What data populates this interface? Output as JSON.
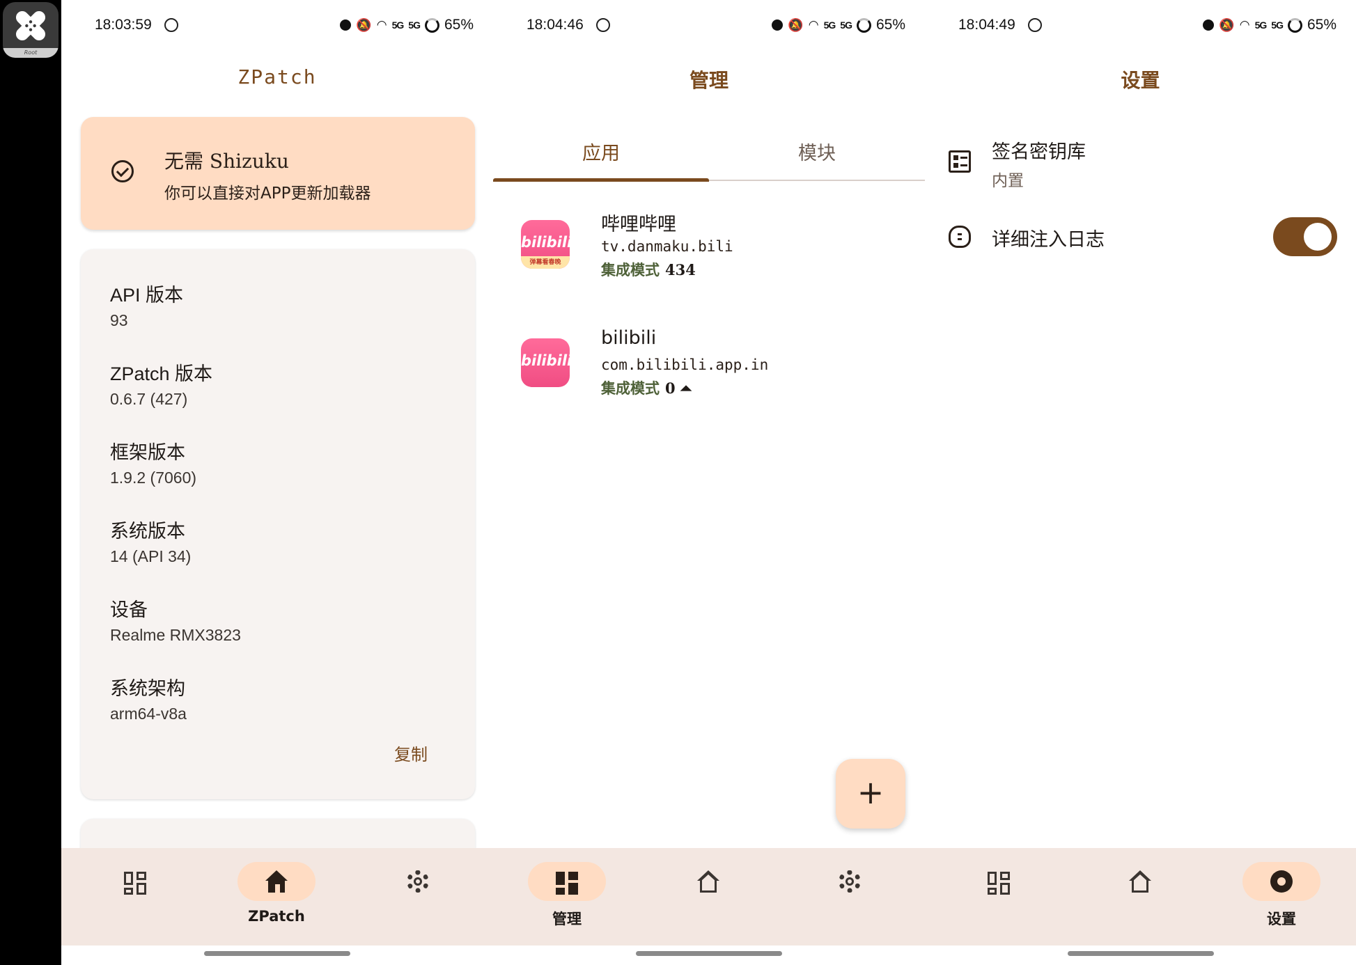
{
  "overlay": {
    "badge_label": "Root"
  },
  "panels": [
    {
      "status": {
        "time": "18:03:59",
        "battery": "65%",
        "signal1": "5G",
        "signal2": "5G"
      },
      "title": "ZPatch",
      "status_card": {
        "title": "无需 Shizuku",
        "subtitle": "你可以直接对APP更新加载器"
      },
      "info": [
        {
          "label": "API 版本",
          "value": "93"
        },
        {
          "label": "ZPatch 版本",
          "value": "0.6.7 (427)"
        },
        {
          "label": "框架版本",
          "value": "1.9.2 (7060)"
        },
        {
          "label": "系统版本",
          "value": "14 (API 34)"
        },
        {
          "label": "设备",
          "value": "Realme RMX3823"
        },
        {
          "label": "系统架构",
          "value": "arm64-v8a"
        }
      ],
      "copy_label": "复制",
      "nav": {
        "active_label": "ZPatch"
      }
    },
    {
      "status": {
        "time": "18:04:46",
        "battery": "65%",
        "signal1": "5G",
        "signal2": "5G"
      },
      "title": "管理",
      "tabs": [
        "应用",
        "模块"
      ],
      "apps": [
        {
          "name": "哔哩哔哩",
          "package": "tv.danmaku.bili",
          "mode": "集成模式",
          "count": "434",
          "icon_text": "bilibili",
          "icon_strip": "弹幕看春晚"
        },
        {
          "name": "bilibili",
          "package": "com.bilibili.app.in",
          "mode": "集成模式",
          "count": "0 ⏶",
          "icon_text": "bilibili"
        }
      ],
      "fab_label": "+",
      "nav": {
        "active_label": "管理"
      }
    },
    {
      "status": {
        "time": "18:04:49",
        "battery": "65%",
        "signal1": "5G",
        "signal2": "5G"
      },
      "title": "设置",
      "settings": [
        {
          "title": "签名密钥库",
          "subtitle": "内置"
        },
        {
          "title": "详细注入日志",
          "toggle": true
        }
      ],
      "nav": {
        "active_label": "设置"
      }
    }
  ],
  "colors": {
    "accent": "#7a4a1e",
    "pill": "#ffdcc3",
    "nav_bg": "#f3e7e1",
    "mode_green": "#4e6138"
  }
}
